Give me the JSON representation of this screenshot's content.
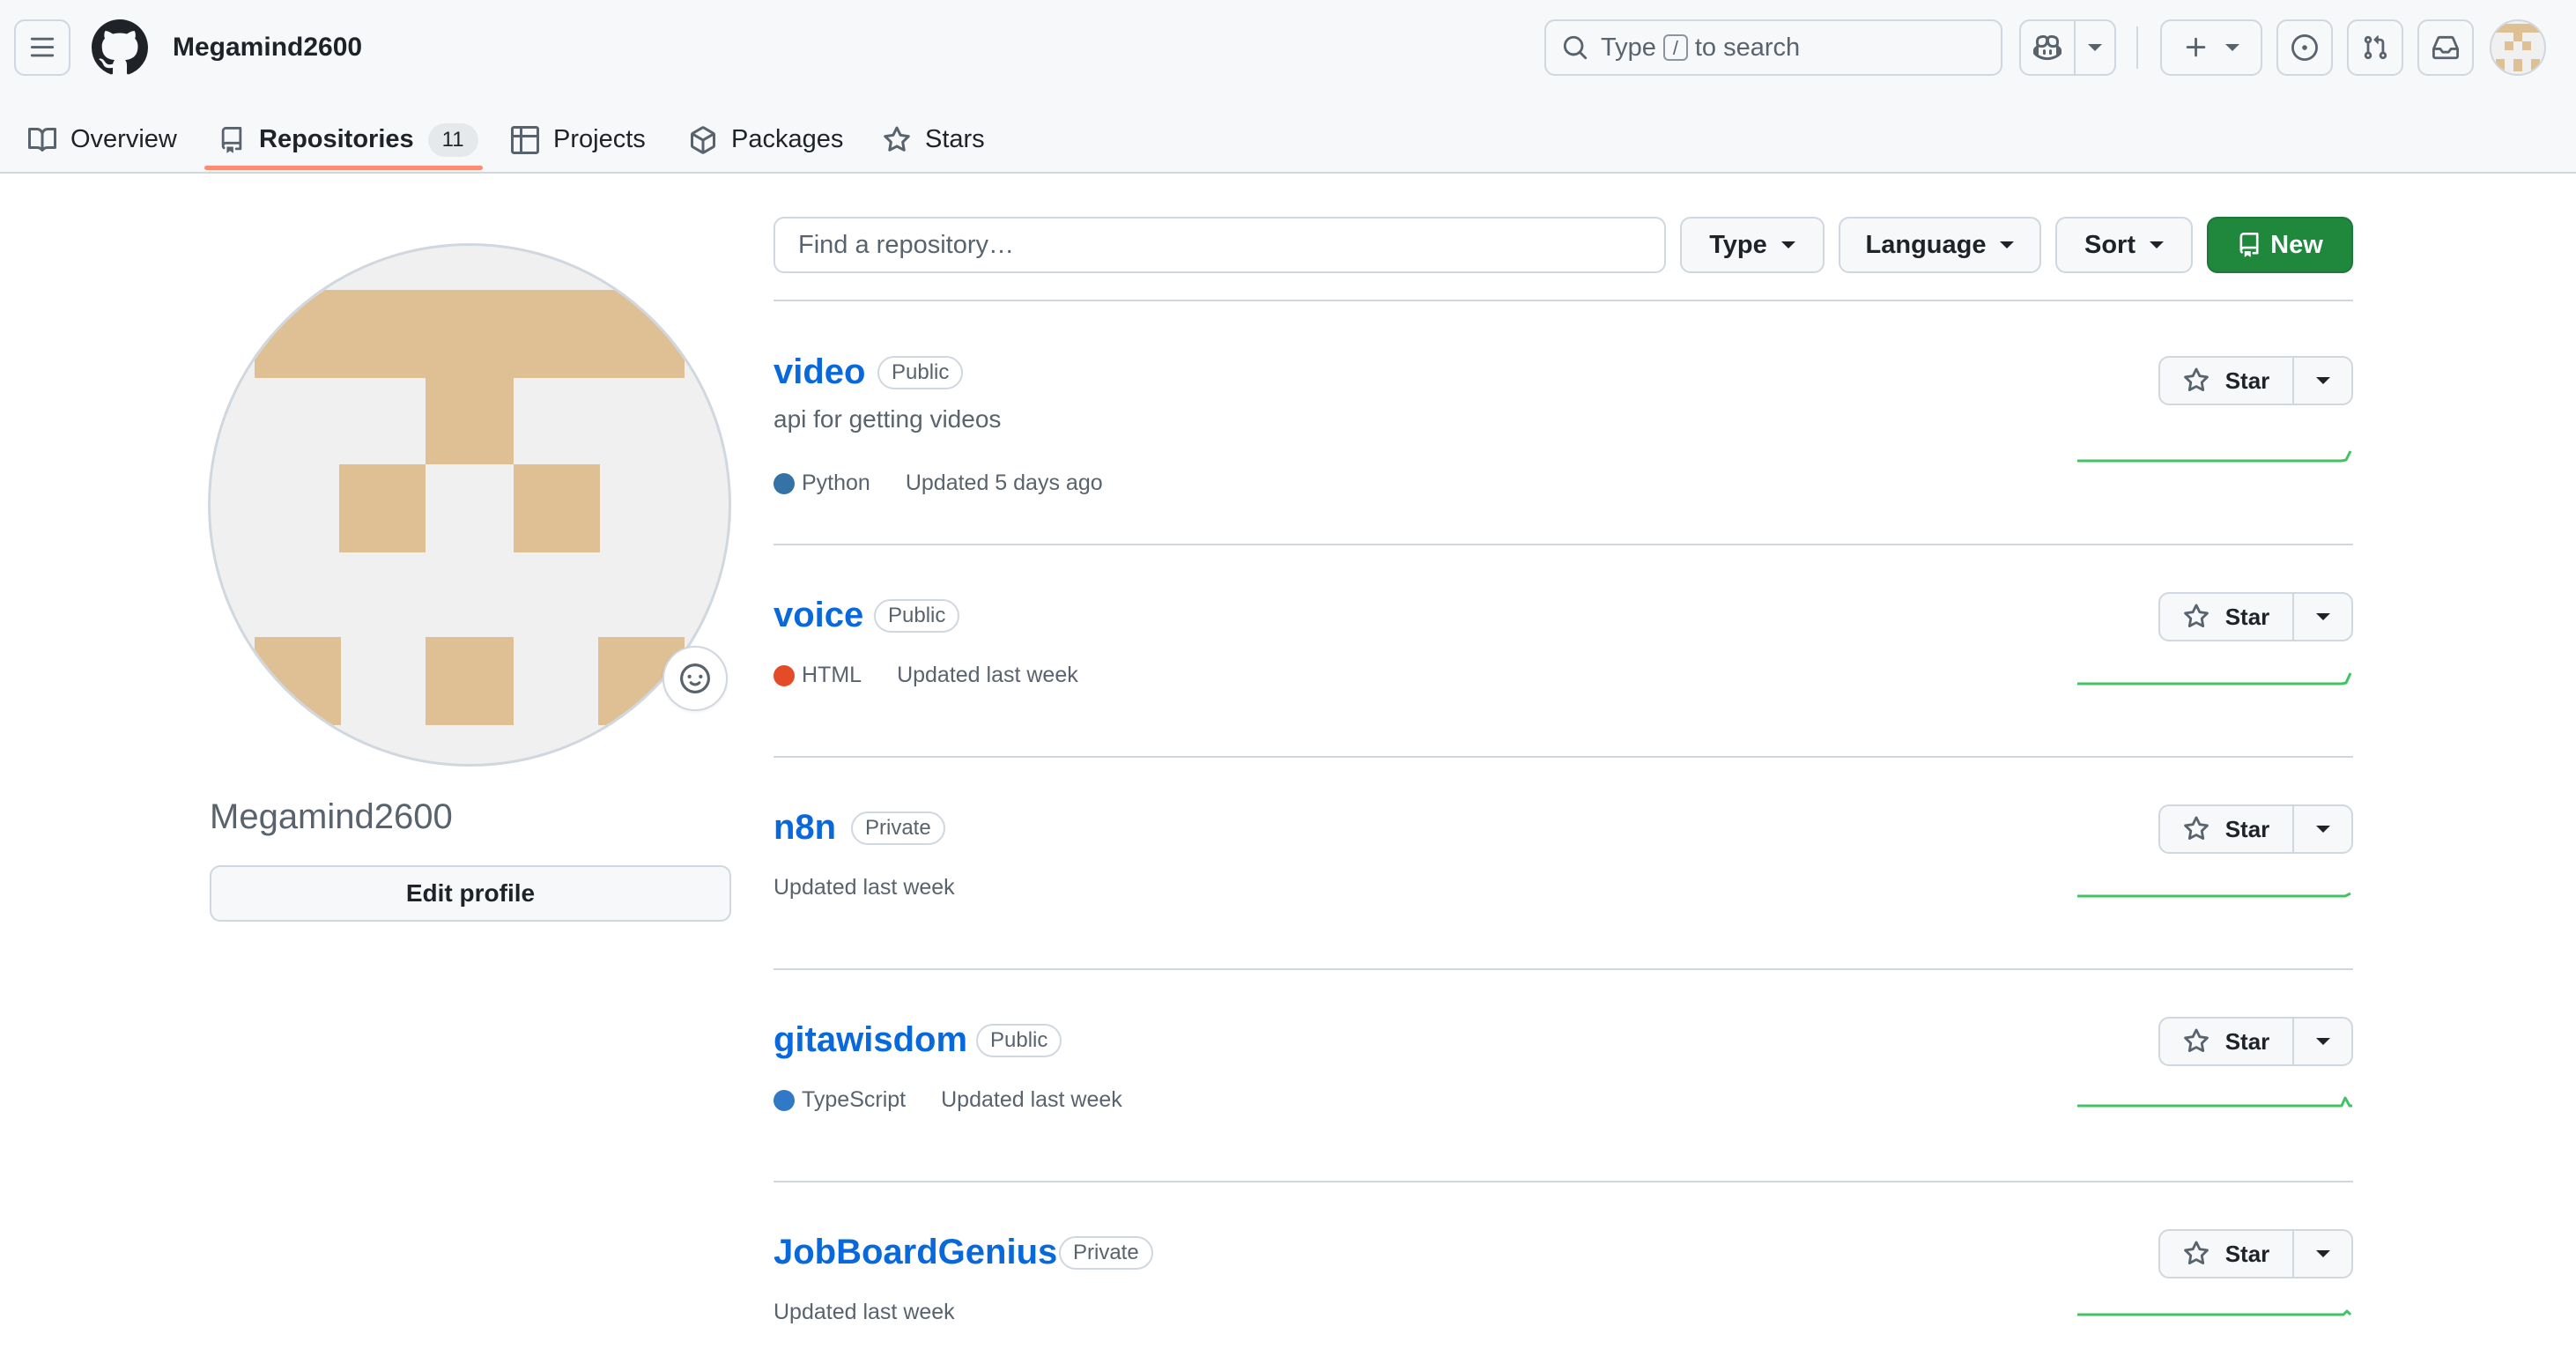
{
  "header": {
    "username": "Megamind2600",
    "search": {
      "prefix": "Type",
      "key": "/",
      "suffix": "to search"
    }
  },
  "tabs": [
    {
      "label": "Overview",
      "icon": "book-icon"
    },
    {
      "label": "Repositories",
      "icon": "repo-icon",
      "count": "11",
      "active": true
    },
    {
      "label": "Projects",
      "icon": "table-icon"
    },
    {
      "label": "Packages",
      "icon": "package-icon"
    },
    {
      "label": "Stars",
      "icon": "star-icon"
    }
  ],
  "profile": {
    "name": "Megamind2600",
    "edit_label": "Edit profile"
  },
  "toolbar": {
    "find_placeholder": "Find a repository…",
    "type_label": "Type",
    "language_label": "Language",
    "sort_label": "Sort",
    "new_label": "New"
  },
  "colors": {
    "accent": "#0969da",
    "new_button": "#1f883d",
    "tab_underline": "#fd8c73",
    "avatar_tan": "#dfbf94",
    "avatar_bg": "#f0f0f0",
    "sparkline": "#40c463"
  },
  "repos": [
    {
      "name": "video",
      "visibility": "Public",
      "description": "api for getting videos",
      "language": "Python",
      "language_color": "#3572A5",
      "updated": "Updated 5 days ago",
      "star_label": "Star"
    },
    {
      "name": "voice",
      "visibility": "Public",
      "description": "",
      "language": "HTML",
      "language_color": "#e34c26",
      "updated": "Updated last week",
      "star_label": "Star"
    },
    {
      "name": "n8n",
      "visibility": "Private",
      "description": "",
      "language": "",
      "language_color": "",
      "updated": "Updated last week",
      "star_label": "Star"
    },
    {
      "name": "gitawisdom",
      "visibility": "Public",
      "description": "",
      "language": "TypeScript",
      "language_color": "#3178c6",
      "updated": "Updated last week",
      "star_label": "Star"
    },
    {
      "name": "JobBoardGenius",
      "visibility": "Private",
      "description": "",
      "language": "",
      "language_color": "",
      "updated": "Updated last week",
      "star_label": "Star"
    }
  ]
}
